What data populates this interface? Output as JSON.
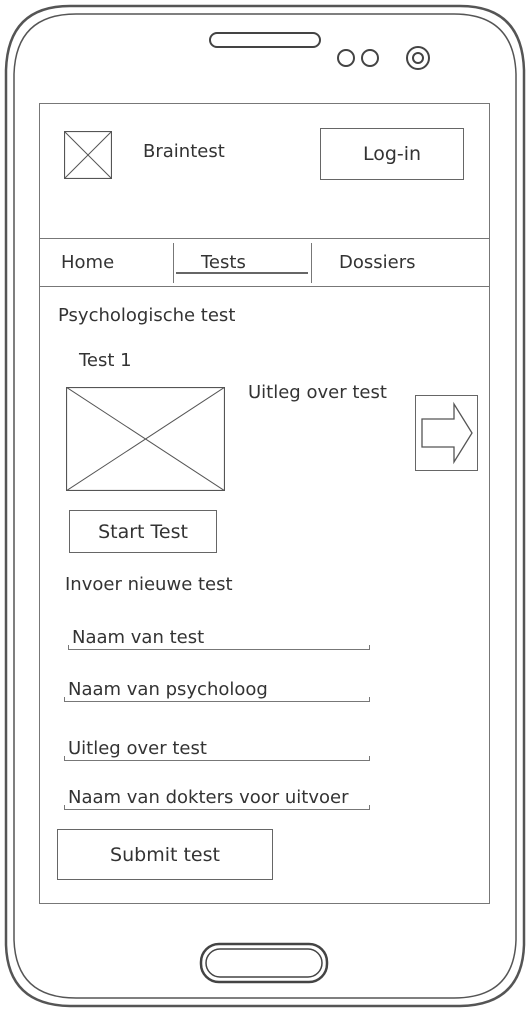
{
  "app": {
    "title": "Braintest",
    "login_label": "Log-in"
  },
  "nav": {
    "items": [
      "Home",
      "Tests",
      "Dossiers"
    ],
    "active": "Tests"
  },
  "content": {
    "section_title": "Psychologische test",
    "test_title": "Test 1",
    "test_description": "Uitleg over test",
    "start_button": "Start Test",
    "new_test_heading": "Invoer nieuwe test",
    "fields": [
      {
        "placeholder": "Naam van test"
      },
      {
        "placeholder": "Naam van psycholoog"
      },
      {
        "placeholder": "Uitleg over test"
      },
      {
        "placeholder": "Naam van dokters voor uitvoer"
      }
    ],
    "submit_button": "Submit test"
  }
}
